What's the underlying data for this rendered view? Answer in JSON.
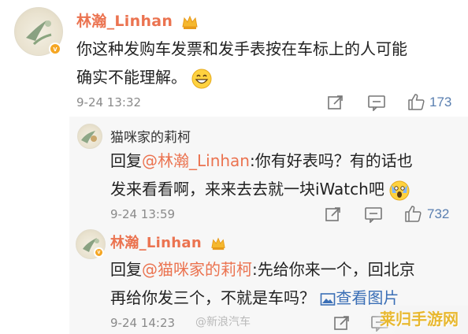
{
  "comments": [
    {
      "username": "林瀚_Linhan",
      "text_line1": "你这种发购车发票和发手表按在车标上的人可能",
      "text_line2": "确实不能理解。",
      "timestamp": "9-24 13:32",
      "likes": "173"
    }
  ],
  "replies": [
    {
      "username": "猫咪家的莉柯",
      "prefix": "回复",
      "mention": "@林瀚_Linhan",
      "text_line1_rest": ":你有好表吗？有的话也",
      "text_line2": "发来看看啊，来来去去就一块iWatch吧",
      "timestamp": "9-24 13:59",
      "likes": "732"
    },
    {
      "username": "林瀚_Linhan",
      "prefix": "回复",
      "mention": "@猫咪家的莉柯",
      "text_line1_rest": ":先给你来一个，回北京",
      "text_line2": "再给你发三个，不就是车吗？",
      "view_image_label": "查看图片",
      "timestamp": "9-24 14:23"
    }
  ],
  "watermark": "@新浪汽车",
  "corner_logo": "莱归手游网",
  "colors": {
    "username": "#eb7350",
    "link": "#3b6fb6",
    "meta": "#8a8a8a",
    "reply_bg": "#f7f7f7"
  },
  "icons": [
    "avatar-image",
    "verified-badge",
    "crown-icon",
    "grin-emoji",
    "scream-emoji",
    "share-icon",
    "comment-icon",
    "thumbs-up-icon",
    "image-icon"
  ]
}
